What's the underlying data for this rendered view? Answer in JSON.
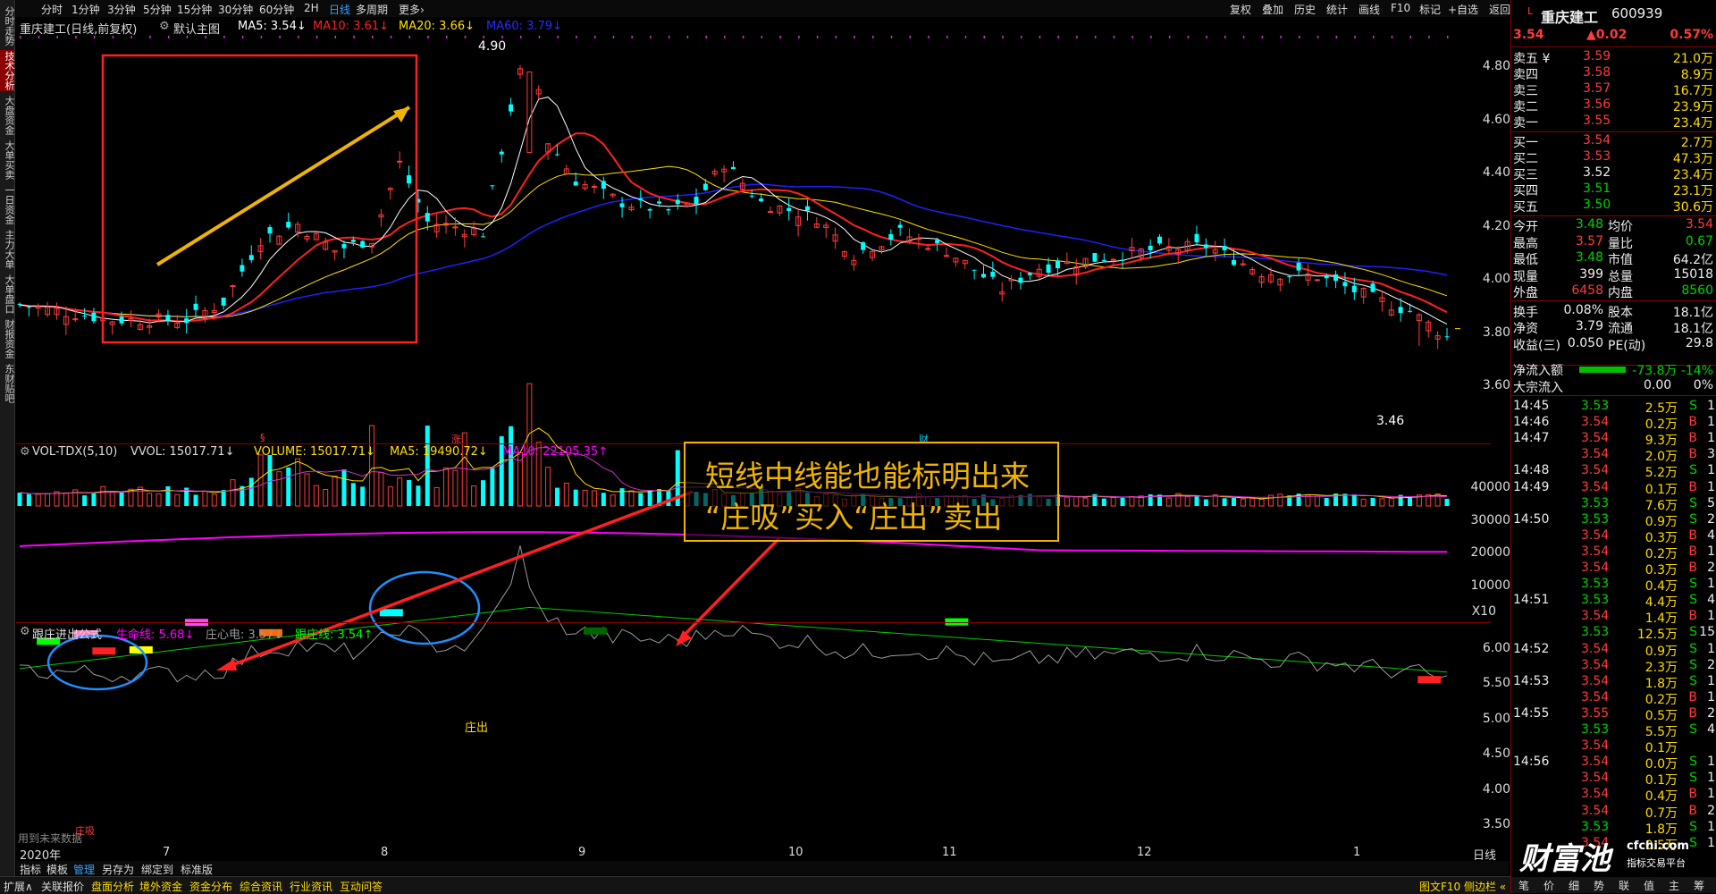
{
  "left_tabs": [
    "分时走势",
    "技术分析",
    "大盘资金",
    "大单买卖",
    "一日资金",
    "主力大单",
    "大单盘口",
    "财报资金",
    "东财贴吧"
  ],
  "period_bar": {
    "items": [
      "分时",
      "1分钟",
      "3分钟",
      "5分钟",
      "15分钟",
      "30分钟",
      "60分钟",
      "2H",
      "日线",
      "多周期",
      "更多›"
    ],
    "active": "日线",
    "tools": [
      "复权",
      "叠加",
      "历史",
      "统计",
      "画线",
      "F10",
      "标记",
      "+自选",
      "返回"
    ]
  },
  "main_title": {
    "stock": "重庆建工(日线,前复权)",
    "chart_name": "默认主图",
    "ma5": "MA5: 3.54↓",
    "ma10": "MA10: 3.61↓",
    "ma20": "MA20: 3.66↓",
    "ma60": "MA60: 3.79↓"
  },
  "main_y_axis": [
    "4.80",
    "4.60",
    "4.40",
    "4.20",
    "4.00",
    "3.80",
    "3.60"
  ],
  "price_high_label": "4.90",
  "price_low_label": "3.46",
  "vol_title": {
    "name": "VOL-TDX(5,10)",
    "vvol": "VVOL: 15017.71↓",
    "volume": "VOLUME: 15017.71↓",
    "ma5": "MA5: 19490.72↓",
    "ma10": "MA10: 22105.35↑"
  },
  "vol_y_axis": [
    "40000",
    "30000",
    "20000",
    "10000",
    "X10"
  ],
  "ind_title": {
    "name": "跟庄进出公式",
    "life": "生命线: 5.68↓",
    "center": "庄心电: 3.57↓",
    "follow": "跟庄线: 3.54↑"
  },
  "ind_y_axis": [
    "6.00",
    "5.50",
    "5.00",
    "4.50",
    "4.00",
    "3.50"
  ],
  "x_axis": {
    "year": "2020年",
    "months": [
      "7",
      "8",
      "9",
      "10",
      "11",
      "12",
      "1"
    ],
    "period": "日线"
  },
  "chart_markers": {
    "m1": "§",
    "m2": "涨",
    "m3": "财",
    "zhuangchu": "庄出",
    "zhuangxi": "庄吸",
    "bottom_note": "用到未来数据"
  },
  "annotation": {
    "line1": "短线中线能也能标明出来",
    "line2": "“庄吸”买入“庄出”卖出"
  },
  "bottom_tabs": [
    "指标",
    "模板",
    "管理",
    "另存为",
    "绑定到",
    "标准版"
  ],
  "bottom_bar": [
    "扩展∧",
    "关联报价",
    "盘面分析",
    "境外资金",
    "资金分布",
    "综合资讯",
    "行业资讯",
    "互动问答"
  ],
  "bottom_right": "图文F10 侧边栏 «",
  "quote": {
    "name": "重庆建工",
    "code": "600939",
    "price": "3.54",
    "change": "▲0.02",
    "pct": "0.57%",
    "asks": [
      [
        "卖五 ¥",
        "3.59",
        "21.0万"
      ],
      [
        "卖四",
        "3.58",
        "8.9万"
      ],
      [
        "卖三",
        "3.57",
        "16.7万"
      ],
      [
        "卖二",
        "3.56",
        "23.9万"
      ],
      [
        "卖一",
        "3.55",
        "23.4万"
      ]
    ],
    "bids": [
      [
        "买一",
        "3.54",
        "2.7万"
      ],
      [
        "买二",
        "3.53",
        "47.3万"
      ],
      [
        "买三",
        "3.52",
        "23.4万"
      ],
      [
        "买四",
        "3.51",
        "23.1万"
      ],
      [
        "买五",
        "3.50",
        "30.6万"
      ]
    ],
    "stats": [
      [
        "今开",
        "3.48",
        "均价",
        "3.54"
      ],
      [
        "最高",
        "3.57",
        "量比",
        "0.67"
      ],
      [
        "最低",
        "3.48",
        "市值",
        "64.2亿"
      ],
      [
        "现量",
        "399",
        "总量",
        "15018"
      ],
      [
        "外盘",
        "6458",
        "内盘",
        "8560"
      ],
      [
        "换手",
        "0.08%",
        "股本",
        "18.1亿"
      ],
      [
        "净资",
        "3.79",
        "流通",
        "18.1亿"
      ],
      [
        "收益(三)",
        "0.050",
        "PE(动)",
        "29.8"
      ]
    ],
    "netflow_label": "净流入额",
    "netflow_value": "-73.8万 -14%",
    "bigflow_label": "大宗流入",
    "bigflow_value": "0.00",
    "bigflow_pct": "0%"
  },
  "ticks": [
    [
      "14:45",
      "3.53",
      "2.5万",
      "S",
      "1"
    ],
    [
      "14:46",
      "3.54",
      "0.2万",
      "B",
      "1"
    ],
    [
      "14:47",
      "3.54",
      "9.3万",
      "B",
      "1"
    ],
    [
      "",
      "3.54",
      "2.0万",
      "B",
      "3"
    ],
    [
      "14:48",
      "3.54",
      "5.2万",
      "S",
      "1"
    ],
    [
      "14:49",
      "3.54",
      "0.1万",
      "B",
      "1"
    ],
    [
      "",
      "3.53",
      "7.6万",
      "S",
      "5"
    ],
    [
      "14:50",
      "3.53",
      "0.9万",
      "S",
      "2"
    ],
    [
      "",
      "3.54",
      "0.3万",
      "B",
      "4"
    ],
    [
      "",
      "3.54",
      "0.2万",
      "B",
      "1"
    ],
    [
      "",
      "3.54",
      "0.3万",
      "B",
      "2"
    ],
    [
      "",
      "3.53",
      "0.4万",
      "S",
      "1"
    ],
    [
      "14:51",
      "3.53",
      "4.4万",
      "S",
      "4"
    ],
    [
      "",
      "3.54",
      "1.4万",
      "B",
      "1"
    ],
    [
      "",
      "3.53",
      "12.5万",
      "S",
      "15"
    ],
    [
      "14:52",
      "3.54",
      "0.9万",
      "S",
      "1"
    ],
    [
      "",
      "3.54",
      "2.3万",
      "S",
      "2"
    ],
    [
      "14:53",
      "3.54",
      "1.8万",
      "S",
      "1"
    ],
    [
      "",
      "3.54",
      "0.2万",
      "B",
      "1"
    ],
    [
      "14:55",
      "3.55",
      "0.5万",
      "B",
      "2"
    ],
    [
      "",
      "3.53",
      "5.5万",
      "S",
      "4"
    ],
    [
      "",
      "3.54",
      "0.1万",
      "",
      ""
    ],
    [
      "14:56",
      "3.54",
      "0.0万",
      "S",
      "1"
    ],
    [
      "",
      "3.54",
      "0.1万",
      "S",
      "1"
    ],
    [
      "",
      "3.54",
      "0.4万",
      "B",
      "1"
    ],
    [
      "",
      "3.54",
      "0.7万",
      "B",
      "2"
    ],
    [
      "",
      "3.53",
      "1.8万",
      "S",
      "1"
    ],
    [
      "",
      "3.54",
      "0.5万",
      "S",
      "1"
    ]
  ],
  "rpanel_bottom": [
    "笔",
    "价",
    "细",
    "势",
    "联",
    "值",
    "主",
    "筹"
  ],
  "watermark": {
    "brand": "财富池",
    "site": "cfchi.com",
    "sub": "指标交易平台"
  },
  "colors": {
    "up": "#ff3b3b",
    "down": "#00ffff",
    "ma5": "#ffffff",
    "ma10": "#ff2020",
    "ma20": "#ffe000",
    "ma60": "#2020ff",
    "annot": "#f0b400"
  }
}
